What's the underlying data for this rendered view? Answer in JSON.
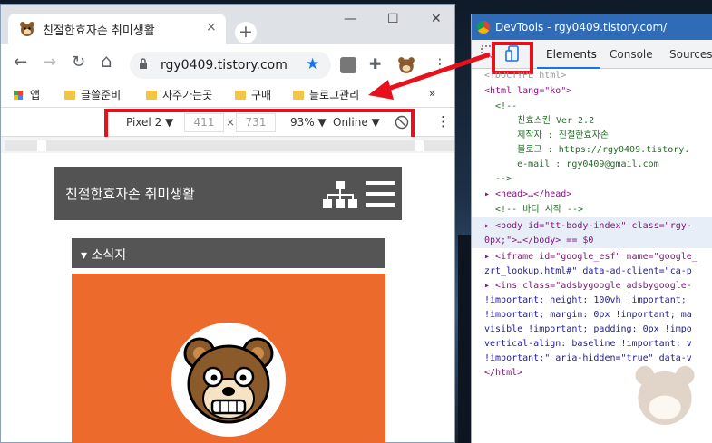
{
  "browser": {
    "tab_title": "친절한효자손 취미생활",
    "tab_close": "×",
    "new_tab": "+",
    "window_controls": {
      "minimize": "—",
      "maximize": "☐",
      "close": "✕"
    },
    "nav": {
      "back": "←",
      "forward": "→",
      "reload": "↻",
      "home": "⌂"
    },
    "url": "rgy0409.tistory.com",
    "bookmarks": [
      "앱",
      "글쓸준비",
      "자주가는곳",
      "구매",
      "블로그관리"
    ],
    "bookmarks_more": "»",
    "device_toolbar": {
      "device": "Pixel 2 ▼",
      "width": "411",
      "times": "×",
      "height": "731",
      "zoom": "93% ▼",
      "network": "Online ▼",
      "more": "⋮"
    }
  },
  "site": {
    "header_title": "친절한효자손 취미생활",
    "widget_title": "▾ 소식지"
  },
  "devtools": {
    "window_title": "DevTools - rgy0409.tistory.com/",
    "tabs": [
      "Elements",
      "Console",
      "Sources"
    ],
    "code_lines": [
      "<!DOCTYPE html>",
      "<html lang=\"ko\">",
      "  <!--",
      "      친효스킨 Ver 2.2",
      "      제작자 : 친절한효자손",
      "      블로그 : https://rgy0409.tistory.",
      "      e-mail : rgy0409@gmail.com",
      "  -->",
      "▸ <head>…</head>",
      "  <!-- 바디 시작 -->",
      "▸ <body id=\"tt-body-index\" class=\"rgy-",
      "0px;\">…</body> == $0",
      "▸ <iframe id=\"google_esf\" name=\"google_",
      "zrt_lookup.html#\" data-ad-client=\"ca-p",
      "▸ <ins class=\"adsbygoogle adsbygoogle-",
      "!important; height: 100vh !important;",
      "!important; margin: 0px !important; ma",
      "visible !important; padding: 0px !impo",
      "vertical-align: baseline !important; v",
      "!important;\" aria-hidden=\"true\" data-v",
      "</html>"
    ]
  },
  "colors": {
    "highlight": "#e8101a",
    "site_header": "#535353",
    "banner": "#eb6a2c"
  }
}
